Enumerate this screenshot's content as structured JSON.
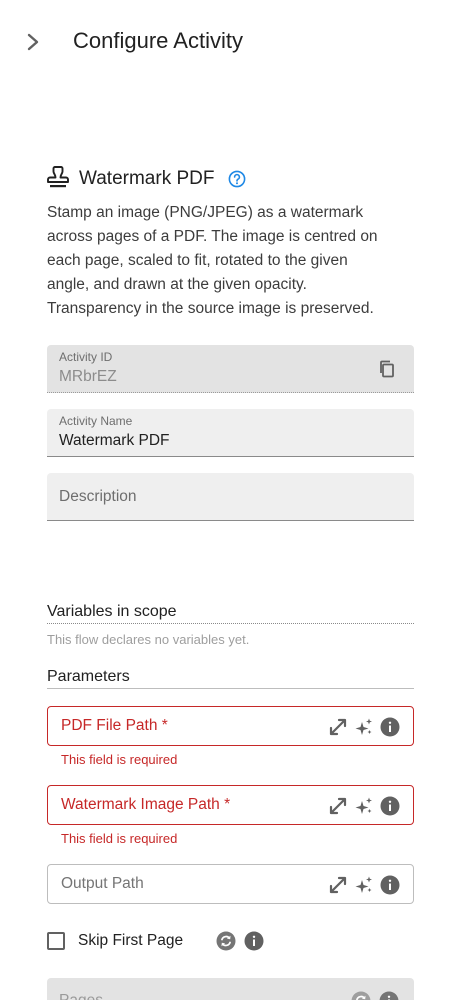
{
  "header": {
    "title": "Configure Activity"
  },
  "activity": {
    "name": "Watermark PDF",
    "description": "Stamp an image (PNG/JPEG) as a watermark across pages of a PDF. The image is centred on each page, scaled to fit, rotated to the given angle, and drawn at the given opacity. Transparency in the source image is preserved."
  },
  "fields": {
    "activity_id": {
      "label": "Activity ID",
      "value": "MRbrEZ"
    },
    "activity_name": {
      "label": "Activity Name",
      "value": "Watermark PDF"
    },
    "description": {
      "placeholder": "Description"
    }
  },
  "variables": {
    "title": "Variables in scope",
    "note": "This flow declares no variables yet."
  },
  "parameters": {
    "title": "Parameters",
    "pdf_file_path": {
      "label": "PDF File Path *",
      "error": "This field is required"
    },
    "watermark_image_path": {
      "label": "Watermark Image Path *",
      "error": "This field is required"
    },
    "output_path": {
      "label": "Output Path"
    },
    "skip_first_page": {
      "label": "Skip First Page",
      "checked": false
    },
    "pages": {
      "label": "Pages"
    }
  },
  "icons": {
    "collapse": "chevron-right-icon",
    "activity": "stamp-icon",
    "help": "help-circle-icon",
    "copy": "copy-icon",
    "expand": "expand-arrows-icon",
    "ai": "sparkle-icon",
    "info": "info-icon",
    "reset": "refresh-icon"
  },
  "colors": {
    "accent": "#1e88e5",
    "error": "#c62828",
    "icon_grey": "#616161"
  }
}
